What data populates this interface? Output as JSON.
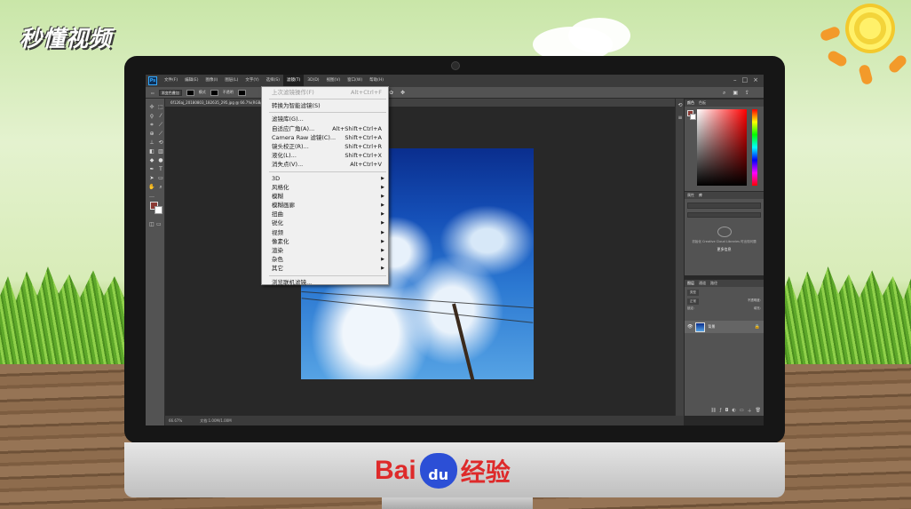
{
  "overlay": {
    "site_logo": "秒懂视频",
    "brand_left": "Bai",
    "brand_paw": "du",
    "brand_right": "经验"
  },
  "ps": {
    "app_icon": "Ps",
    "menus": [
      "文件(F)",
      "编辑(E)",
      "图像(I)",
      "图层(L)",
      "文字(Y)",
      "选择(S)",
      "滤镜(T)",
      "3D(D)",
      "视图(V)",
      "窗口(W)",
      "帮助(H)"
    ],
    "active_menu": "滤镜(T)",
    "options": {
      "style": "渐变色叠加",
      "mode_label": "模式",
      "opacity_label": "不透明"
    },
    "document_tab": "6f126aj_20180803_182635_295.jpg @ 66.7%(RGB/8#)",
    "status": {
      "zoom": "66.67%",
      "doc_size": "文档:1.00M/1.00M"
    },
    "panels": {
      "color_tabs": [
        "颜色",
        "色板"
      ],
      "libraries_tabs": [
        "属性",
        "库"
      ],
      "libraries_msg": "初始化 Creative Cloud Libraries 时出现问题",
      "libraries_btn": "更多信息",
      "layers_tabs": [
        "图层",
        "通道",
        "路径"
      ],
      "layer_kind": "类型",
      "layer_mode": "正常",
      "layer_opacity": "不透明度:",
      "layer_lock": "锁定:",
      "layer_fill": "填充:",
      "layer_name": "背景"
    },
    "filter_menu": [
      {
        "label": "上次滤镜操作(F)",
        "shortcut": "Alt+Ctrl+F",
        "disabled": true
      },
      {
        "sep": true
      },
      {
        "label": "转换为智能滤镜(S)"
      },
      {
        "sep": true
      },
      {
        "label": "滤镜库(G)..."
      },
      {
        "label": "自适应广角(A)...",
        "shortcut": "Alt+Shift+Ctrl+A"
      },
      {
        "label": "Camera Raw 滤镜(C)...",
        "shortcut": "Shift+Ctrl+A"
      },
      {
        "label": "镜头校正(R)...",
        "shortcut": "Shift+Ctrl+R"
      },
      {
        "label": "液化(L)...",
        "shortcut": "Shift+Ctrl+X"
      },
      {
        "label": "消失点(V)...",
        "shortcut": "Alt+Ctrl+V"
      },
      {
        "sep": true
      },
      {
        "label": "3D",
        "submenu": true
      },
      {
        "label": "风格化",
        "submenu": true
      },
      {
        "label": "模糊",
        "submenu": true
      },
      {
        "label": "模糊画廊",
        "submenu": true
      },
      {
        "label": "扭曲",
        "submenu": true
      },
      {
        "label": "锐化",
        "submenu": true
      },
      {
        "label": "视频",
        "submenu": true
      },
      {
        "label": "像素化",
        "submenu": true
      },
      {
        "label": "渲染",
        "submenu": true
      },
      {
        "label": "杂色",
        "submenu": true
      },
      {
        "label": "其它",
        "submenu": true
      },
      {
        "sep": true
      },
      {
        "label": "浏览联机滤镜..."
      }
    ],
    "colors": {
      "foreground": "#8a3a34",
      "background": "#ffffff"
    }
  }
}
